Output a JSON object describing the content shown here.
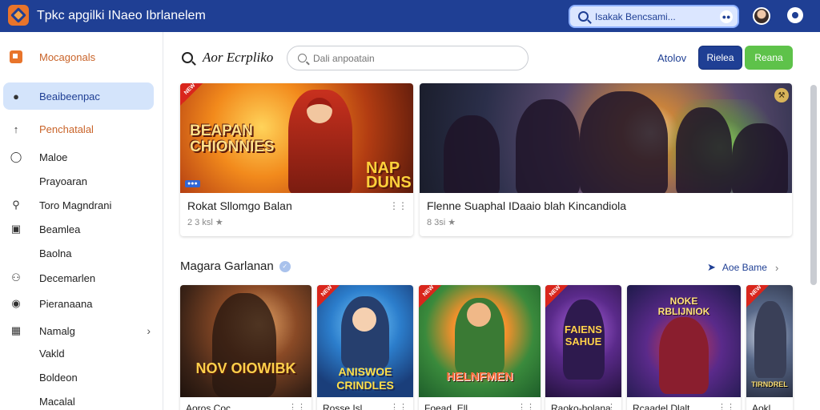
{
  "app": {
    "title": "Tpkc apgilki INaeo Ibrlanelem"
  },
  "topbar": {
    "search_placeholder": "Isakak Bencsami...",
    "toggle_glyph": "●●"
  },
  "sidebar": {
    "items": [
      {
        "label": "Mocagonals",
        "icon": "brand-icon"
      },
      {
        "label": "Beaibeenpac",
        "icon": "user-icon",
        "active": true
      },
      {
        "label": "Penchatalal",
        "icon": "upload-icon"
      },
      {
        "label": "Maloe",
        "icon": "person-icon"
      },
      {
        "label": "Prayoaran",
        "icon": ""
      },
      {
        "label": "Toro Magndrani",
        "icon": "search-person-icon"
      },
      {
        "label": "Beamlea",
        "icon": "image-icon"
      },
      {
        "label": "Baolna",
        "icon": ""
      },
      {
        "label": "Decemarlen",
        "icon": "group-icon"
      },
      {
        "label": "Pieranaana",
        "icon": "circle-icon"
      },
      {
        "label": "Namalg",
        "icon": "building-icon",
        "chevron": "›"
      },
      {
        "label": "Vakld",
        "icon": ""
      },
      {
        "label": "Boldeon",
        "icon": ""
      },
      {
        "label": "Macalal",
        "icon": ""
      }
    ]
  },
  "main": {
    "page_title": "Aor Ecrpliko",
    "search_placeholder": "Dali anpoatain",
    "link_label": "Atolov",
    "primary_label": "Rielea",
    "green_label": "Reana"
  },
  "featured": [
    {
      "title": "Rokat Sllomgo Balan",
      "meta": "2 3 ksl ★",
      "art_title": "BEAPAN\nCHIONNIES",
      "art_title_b": "NAP\nDUNS",
      "ribbon": "NEW",
      "badge": "●●●"
    },
    {
      "title": "Flenne Suaphal IDaaio blah Kincandiola",
      "meta": "8 3si ★"
    }
  ],
  "section": {
    "title": "Magara Garlanan",
    "see_all": "Aoe Bame"
  },
  "tiles": [
    {
      "name": "Aoros Coc",
      "art_text": "NOV OIOWIBK"
    },
    {
      "name": "Rosse Isl",
      "art_text": "ANISWOE\nCRINDLES",
      "ribbon": "NEW"
    },
    {
      "name": "Foead. Ell",
      "art_text": "HELNFMEN",
      "ribbon": "NEW"
    },
    {
      "name": "Raoko-bolana",
      "art_text": "FAIENS\nSAHUE",
      "ribbon": "NEW"
    },
    {
      "name": "Rcaadel Dlalt",
      "art_text": "NOKE\nRBLIJNIOK"
    },
    {
      "name": "Aokl",
      "art_text": "TIRNDREL",
      "ribbon": "NEW"
    }
  ]
}
